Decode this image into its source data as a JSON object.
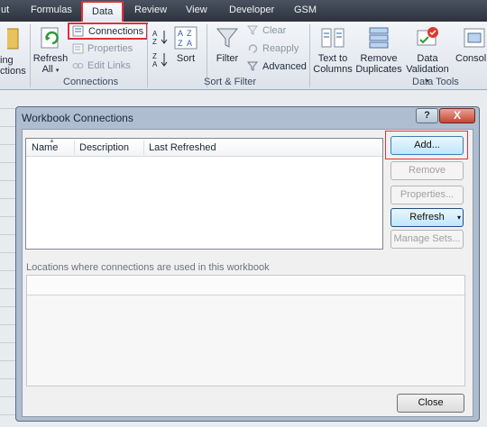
{
  "tabs": [
    {
      "label": "ut"
    },
    {
      "label": "Formulas"
    },
    {
      "label": "Data"
    },
    {
      "label": "Review"
    },
    {
      "label": "View"
    },
    {
      "label": "Developer"
    },
    {
      "label": "GSM"
    }
  ],
  "ribbon": {
    "existing": {
      "line1": "ing",
      "line2": "ctions"
    },
    "refresh_all": {
      "line1": "Refresh",
      "line2": "All"
    },
    "connections": "Connections",
    "properties": "Properties",
    "edit_links": "Edit Links",
    "group_connections": "Connections",
    "sort_az_glyph": "A↓Z",
    "sort": "Sort",
    "filter": "Filter",
    "clear": "Clear",
    "reapply": "Reapply",
    "advanced": "Advanced",
    "group_sort_filter": "Sort & Filter",
    "text_to_columns": {
      "line1": "Text to",
      "line2": "Columns"
    },
    "remove_duplicates": {
      "line1": "Remove",
      "line2": "Duplicates"
    },
    "data_validation": {
      "line1": "Data",
      "line2": "Validation"
    },
    "consolidate": "Consol",
    "group_data_tools": "Data Tools"
  },
  "dialog": {
    "title": "Workbook Connections",
    "help": "?",
    "close": "X",
    "columns": [
      "Name",
      "Description",
      "Last Refreshed"
    ],
    "buttons": {
      "add": "Add...",
      "remove": "Remove",
      "properties": "Properties...",
      "refresh": "Refresh",
      "manage_sets": "Manage Sets...",
      "close": "Close"
    },
    "locations_label": "Locations where connections are used in this workbook"
  },
  "colors": {
    "highlight": "#e0303a",
    "titlebar": "#aebdd0"
  }
}
